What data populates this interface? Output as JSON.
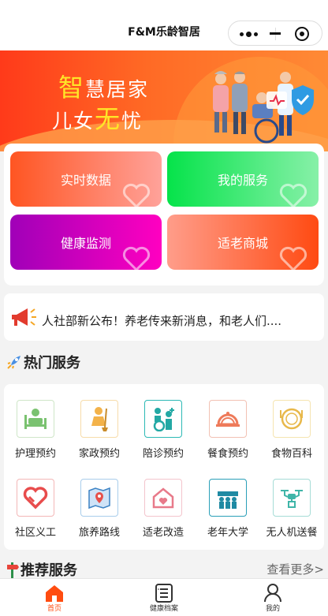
{
  "app": {
    "title": "F&M乐龄智居"
  },
  "banner": {
    "line1_highlight": "智",
    "line1_rest": "慧居家",
    "line2_a": "儿女",
    "line2_highlight": "无",
    "line2_b": "忧"
  },
  "quick": [
    {
      "label": "实时数据"
    },
    {
      "label": "我的服务"
    },
    {
      "label": "健康监测"
    },
    {
      "label": "适老商城"
    }
  ],
  "notice": {
    "text": "人社部新公布！养老传来新消息，和老人们...."
  },
  "hot": {
    "title": "热门服务",
    "items": [
      {
        "label": "护理预约",
        "icon": "nursing-bed-icon"
      },
      {
        "label": "家政预约",
        "icon": "housekeeping-icon"
      },
      {
        "label": "陪诊预约",
        "icon": "accompany-icon"
      },
      {
        "label": "餐食预约",
        "icon": "meal-dome-icon"
      },
      {
        "label": "食物百科",
        "icon": "food-plate-icon"
      },
      {
        "label": "社区义工",
        "icon": "volunteer-heart-icon"
      },
      {
        "label": "旅养路线",
        "icon": "travel-map-icon"
      },
      {
        "label": "适老改造",
        "icon": "home-heart-icon"
      },
      {
        "label": "老年大学",
        "icon": "seniors-group-icon"
      },
      {
        "label": "无人机送餐",
        "icon": "drone-icon"
      }
    ]
  },
  "recommend": {
    "title": "推荐服务",
    "more": "查看更多>"
  },
  "tabbar": [
    {
      "label": "首页",
      "icon": "home-icon",
      "active": true
    },
    {
      "label": "健康档案",
      "icon": "health-record-icon",
      "active": false
    },
    {
      "label": "我的",
      "icon": "profile-icon",
      "active": false
    }
  ],
  "colors": {
    "accent": "#ff4c10",
    "banner": "#ff4a1f"
  }
}
